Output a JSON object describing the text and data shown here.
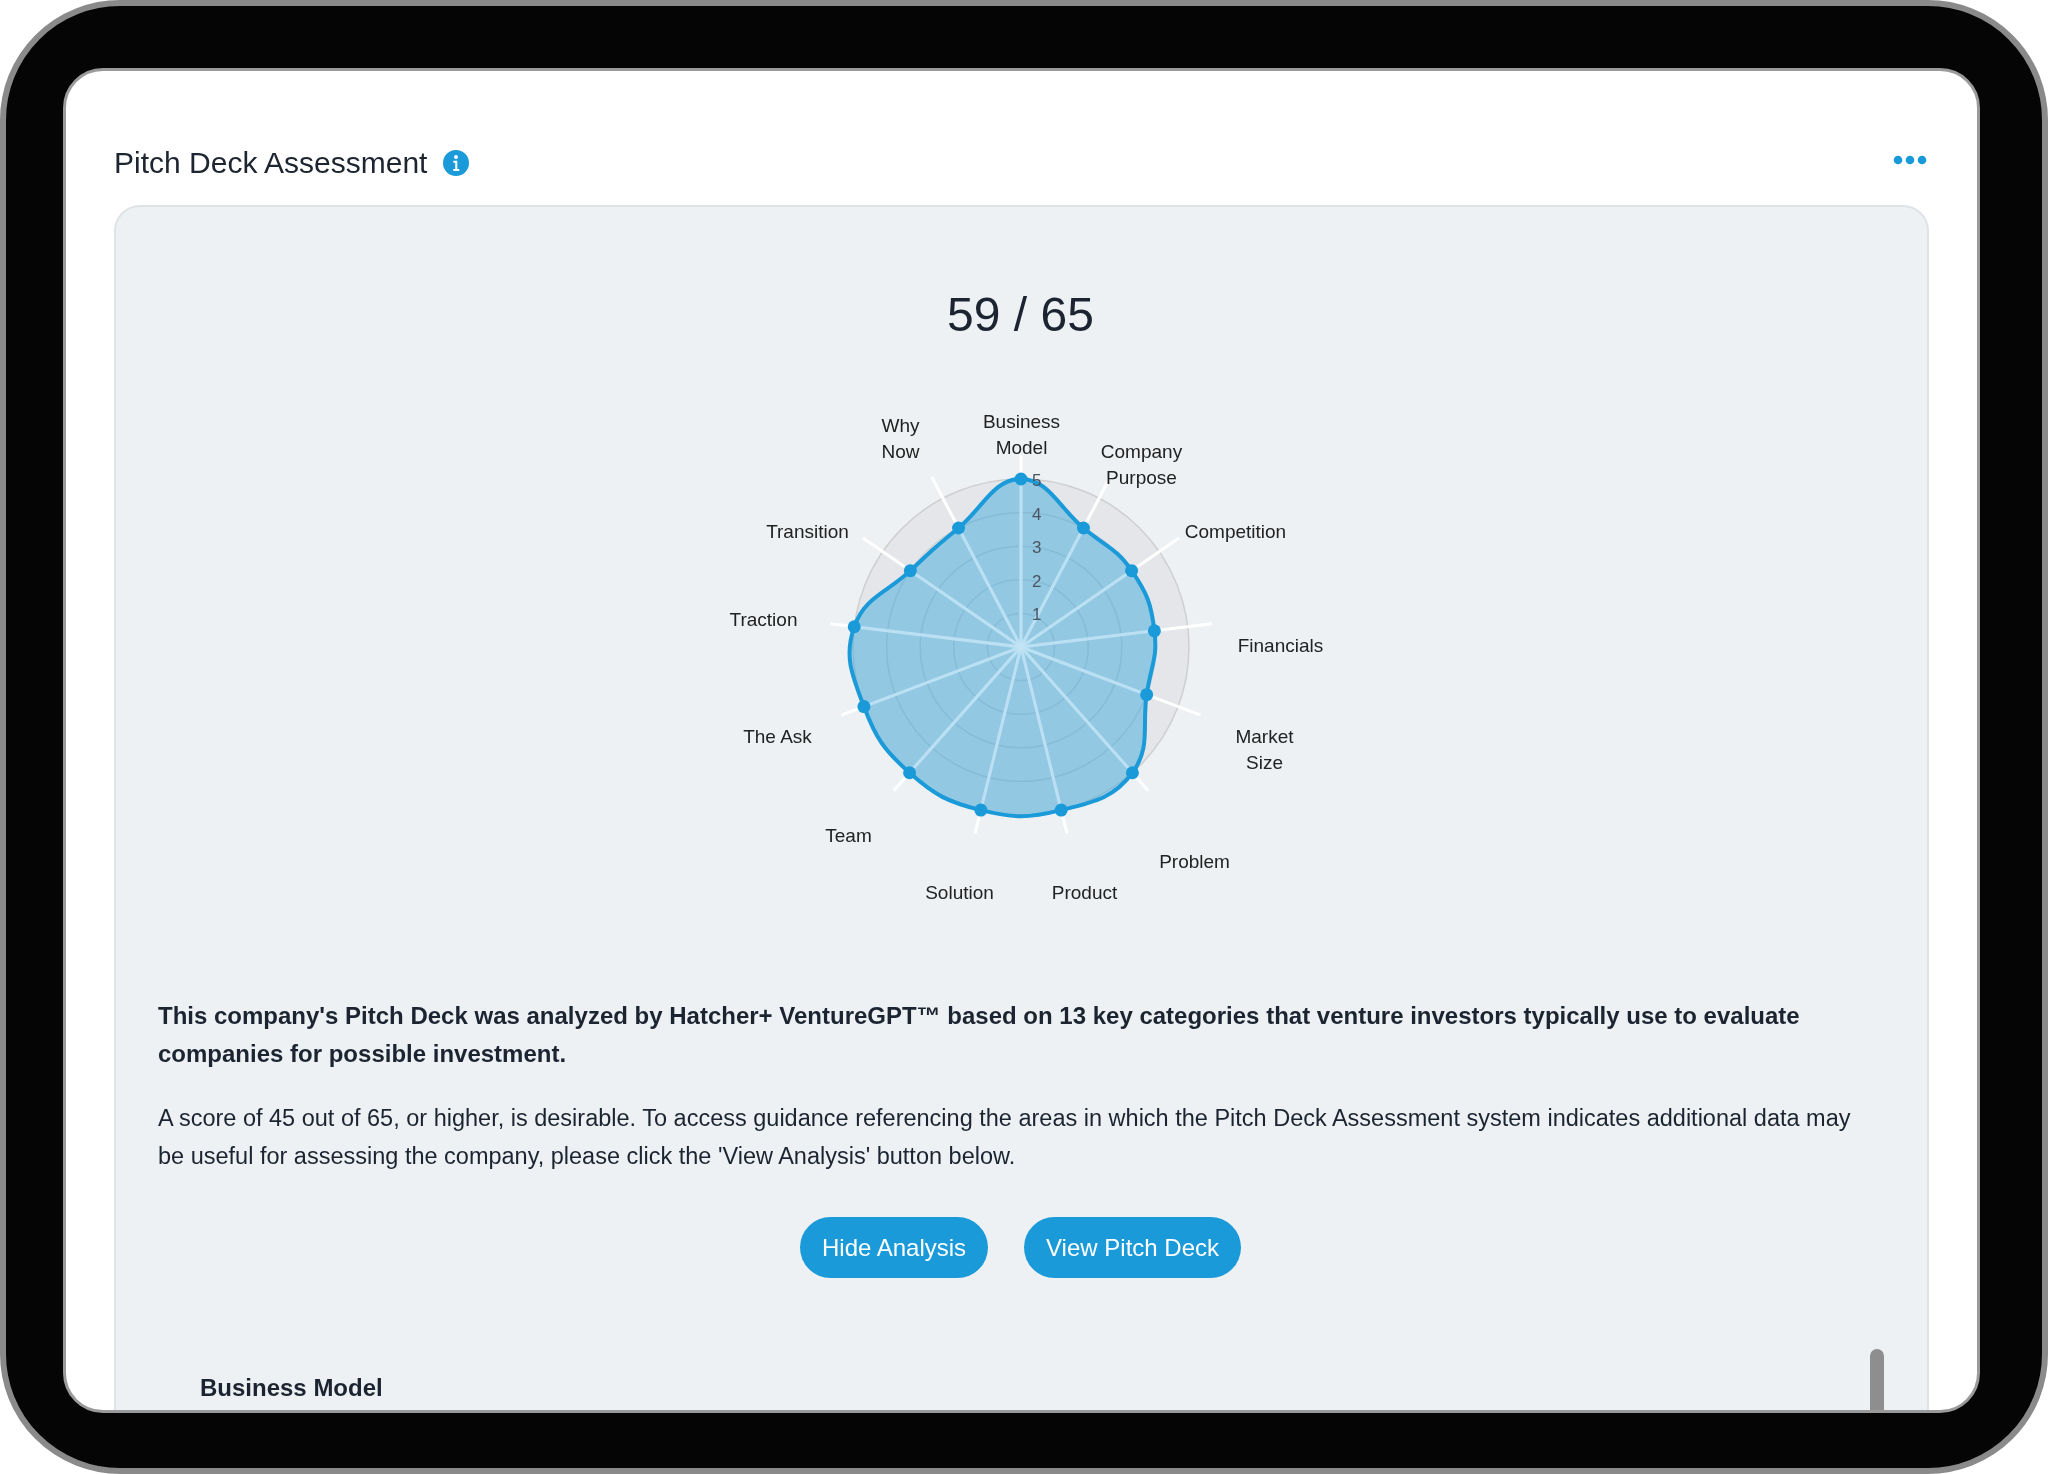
{
  "header": {
    "title": "Pitch Deck Assessment"
  },
  "score": "59 / 65",
  "chart": {
    "chart_data": {
      "type": "radar",
      "categories": [
        "Business Model",
        "Company Purpose",
        "Competition",
        "Financials",
        "Market Size",
        "Problem",
        "Product",
        "Solution",
        "Team",
        "The Ask",
        "Traction",
        "Transition",
        "Why Now"
      ],
      "ylim": [
        0,
        5
      ],
      "yticks": [
        1,
        2,
        3,
        4,
        5
      ],
      "series": [
        {
          "color": "#1a9ad9",
          "values": [
            5,
            4,
            4,
            4,
            4,
            5,
            5,
            5,
            5,
            5,
            5,
            4,
            4
          ]
        }
      ]
    }
  },
  "summary": "This company's Pitch Deck was analyzed by Hatcher+ VentureGPT™ based on 13 key categories that venture investors typically use to evaluate companies for possible investment.",
  "description": "A score of 45 out of 65, or higher, is desirable. To access guidance referencing the areas in which the Pitch Deck Assessment system indicates additional data may be useful for assessing the company, please click the 'View Analysis' button below.",
  "buttons": [
    "Hide Analysis",
    "View Pitch Deck"
  ],
  "section_heading": "Business Model"
}
